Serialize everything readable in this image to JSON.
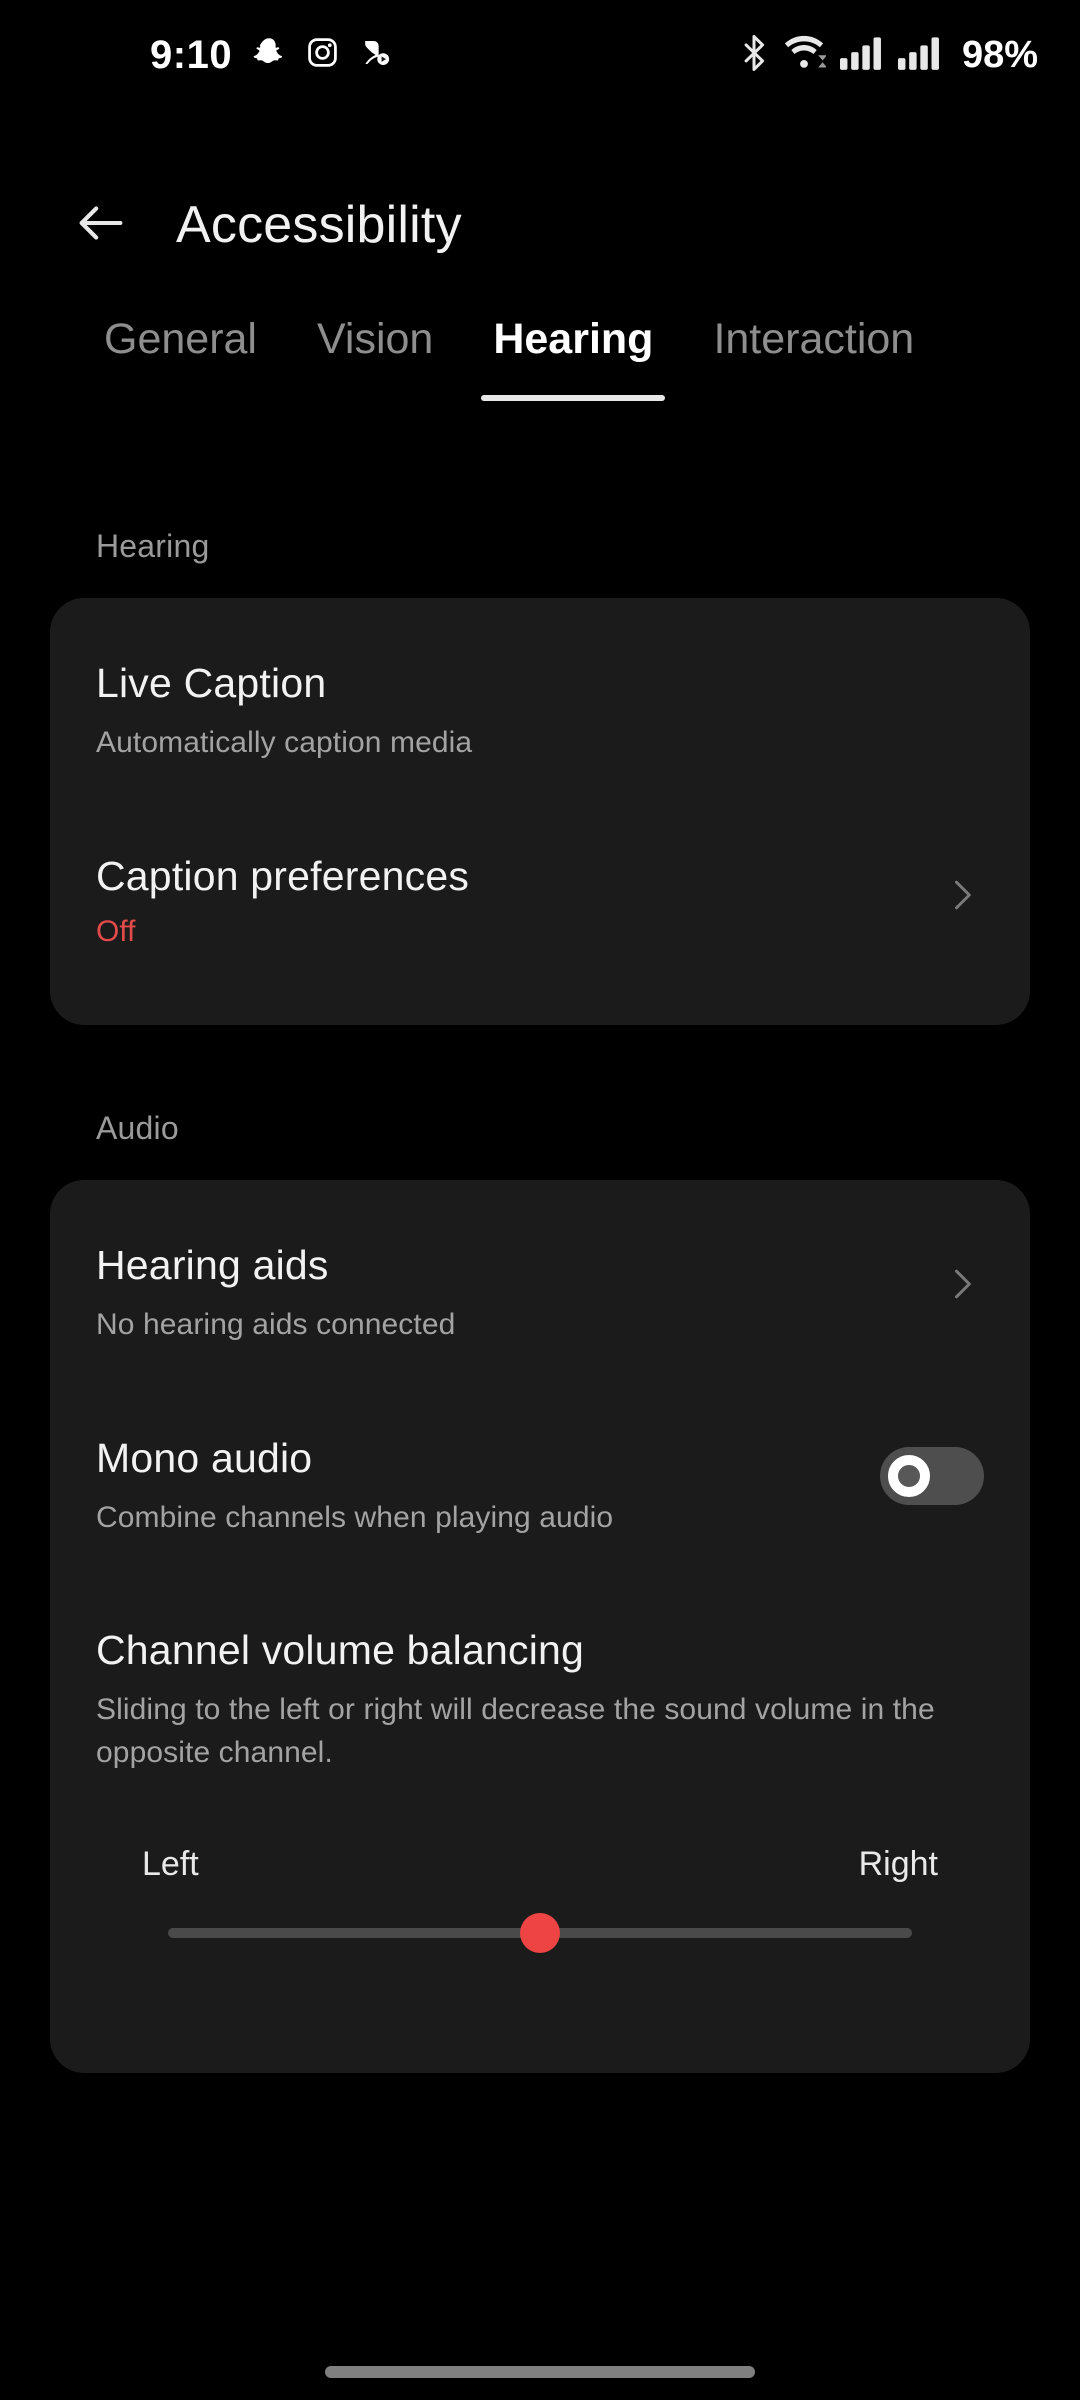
{
  "status_bar": {
    "time": "9:10",
    "battery": "98%",
    "notification_icons": [
      "snapchat-icon",
      "instagram-icon",
      "media-player-icon"
    ],
    "system_icons": [
      "bluetooth-icon",
      "wifi-icon",
      "signal-sim1-icon",
      "signal-sim2-icon"
    ]
  },
  "header": {
    "back_icon": "arrow-left-icon",
    "title": "Accessibility"
  },
  "tabs": {
    "items": [
      {
        "label": "General",
        "active": false
      },
      {
        "label": "Vision",
        "active": false
      },
      {
        "label": "Hearing",
        "active": true
      },
      {
        "label": "Interaction",
        "active": false
      }
    ]
  },
  "sections": [
    {
      "label": "Hearing",
      "rows": [
        {
          "title": "Live Caption",
          "subtitle": "Automatically caption media",
          "control": "none"
        },
        {
          "title": "Caption preferences",
          "status": "Off",
          "status_color": "#e34b4b",
          "control": "chevron-right-icon"
        }
      ]
    },
    {
      "label": "Audio",
      "rows": [
        {
          "title": "Hearing aids",
          "subtitle": "No hearing aids connected",
          "control": "chevron-right-icon"
        },
        {
          "title": "Mono audio",
          "subtitle": "Combine channels when playing audio",
          "control": "toggle",
          "toggle_state": "off"
        },
        {
          "title": "Channel volume balancing",
          "subtitle": "Sliding to the left or right will decrease the sound volume in the opposite channel.",
          "control": "slider",
          "slider": {
            "left_label": "Left",
            "right_label": "Right",
            "value_percent": 50
          }
        }
      ]
    }
  ],
  "nav_bar": {
    "gesture_pill": "home-gesture-pill"
  },
  "colors": {
    "background": "#000000",
    "card": "#1b1b1b",
    "accent_red": "#ef4444",
    "text_primary": "#f2f2f2",
    "text_secondary": "#a3a3a3"
  }
}
